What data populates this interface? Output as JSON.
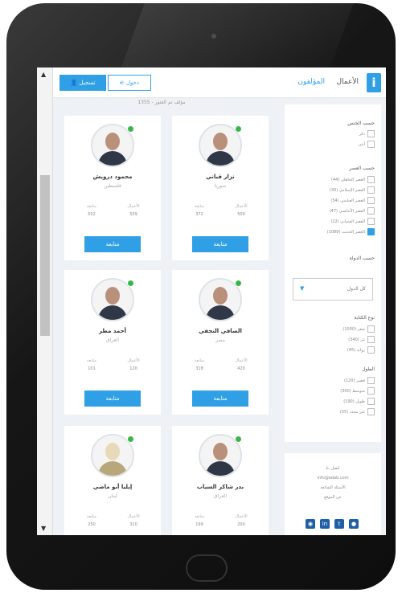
{
  "header": {
    "nav": [
      "الأعمال",
      "المؤلفون"
    ],
    "login_label": "دخول",
    "signup_label": "تسجيل"
  },
  "results_text": "1355 - مؤلف تم العثور",
  "authors": [
    {
      "name": "نزار قباني",
      "country": "سوريا",
      "works": "500",
      "views": "372",
      "follow": "متابعة"
    },
    {
      "name": "محمود درويش",
      "country": "فلسطين",
      "works": "509",
      "views": "502",
      "follow": "متابعة"
    },
    {
      "name": "الصافي النجفي",
      "country": "مصر",
      "works": "420",
      "views": "318",
      "follow": "متابعة"
    },
    {
      "name": "أحمد مطر",
      "country": "العراق",
      "works": "120",
      "views": "101",
      "follow": "متابعة"
    },
    {
      "name": "بدر شاكر السياب",
      "country": "العراق",
      "works": "200",
      "views": "199",
      "follow": "متابعة"
    },
    {
      "name": "إيليا أبو ماضي",
      "country": "لبنان",
      "works": "310",
      "views": "250",
      "follow": "متابعة"
    }
  ],
  "stats_labels": {
    "works": "الأعمال",
    "views": "متابعة"
  },
  "sidebar": {
    "gender_title": "حسب الجنس",
    "gender_options": [
      "ذكر",
      "أنثى"
    ],
    "era_title": "حسب العصر",
    "era_options": [
      "العصر الجاهلي (44)",
      "العصر الإسلامي (30)",
      "العصر العباسي (54)",
      "العصر الأندلسي (47)",
      "العصر العثماني (22)",
      "العصر الحديث (1089)"
    ],
    "era_checked_index": 5,
    "country_title": "حسب الدولة",
    "country_value": "كل الدول",
    "type_title": "نوع الكتابة",
    "type_options": [
      "شعر (1000)",
      "نثر (340)",
      "رواية (45)"
    ],
    "length_title": "الطول",
    "length_options": [
      "قصير (120)",
      "متوسط (300)",
      "طويل (190)",
      "غير محدد (55)"
    ]
  },
  "contact": {
    "lines": [
      "اتصل بنا",
      "info@adab.com",
      "الأسئلة الشائعة",
      "عن الموقع"
    ],
    "social_icons": [
      "camera-icon",
      "linkedin-icon",
      "twitter-icon",
      "user-icon"
    ]
  },
  "colors": {
    "accent": "#2f9fe6",
    "online": "#3bb54a"
  }
}
